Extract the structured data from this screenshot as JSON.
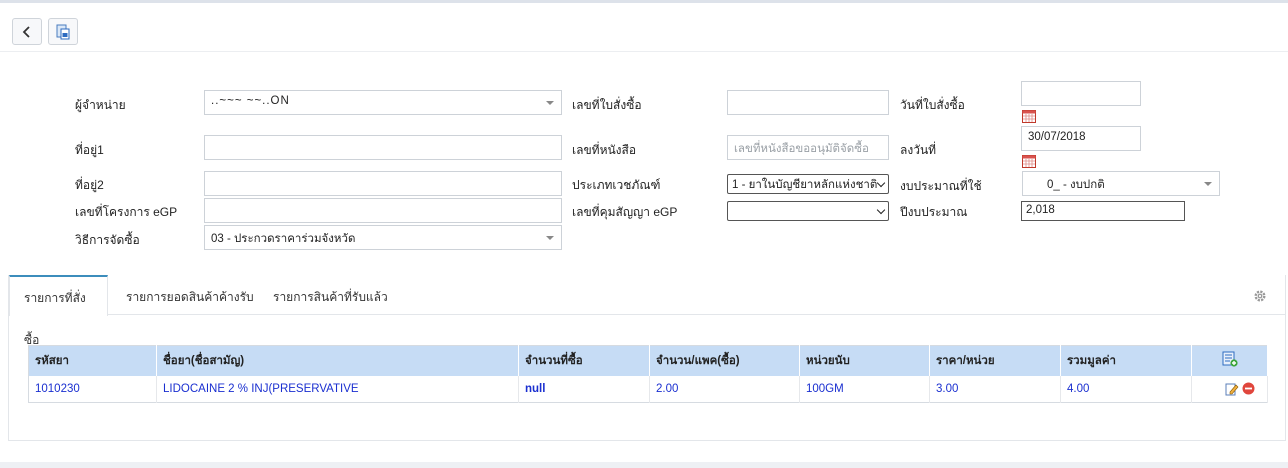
{
  "toolbar": {
    "back_icon": "chevron-left-icon",
    "save_icon": "save-document-icon"
  },
  "form": {
    "vendor_label": "ผู้จำหน่าย",
    "vendor_value": "..~~~  ~~..ON",
    "address1_label": "ที่อยู่1",
    "address1_value": "",
    "address2_label": "ที่อยู่2",
    "address2_value": "",
    "egp_project_label": "เลขที่โครงการ eGP",
    "egp_project_value": "",
    "method_label": "วิธีการจัดซื้อ",
    "method_value": "03 - ประกวดราคาร่วมจังหวัด",
    "po_number_label": "เลขที่ใบสั่งซื้อ",
    "po_number_value": "",
    "letter_no_label": "เลขที่หนังสือ",
    "letter_no_placeholder": "เลขที่หนังสือขออนุมัติจัดซื้อ",
    "drug_type_label": "ประเภทเวชภัณฑ์",
    "drug_type_value": "1 - ยาในบัญชียาหลักแห่งชาติ",
    "contract_egp_label": "เลขที่คุมสัญญา eGP",
    "contract_egp_value": "",
    "po_date_label": "วันที่ใบสั่งซื้อ",
    "po_date_value": "",
    "sign_date_label": "ลงวันที่",
    "sign_date_value": "30/07/2018",
    "budget_label": "งบประมาณที่ใช้",
    "budget_value": "0_ - งบปกติ",
    "fiscal_year_label": "ปีงบประมาณ",
    "fiscal_year_value": "2,018"
  },
  "tabs": [
    "รายการที่สั่งซื้อ",
    "รายการยอดสินค้าค้างรับ",
    "รายการสินค้าที่รับแล้ว"
  ],
  "table": {
    "headers": [
      "รหัสยา",
      "ชื่อยา(ชื่อสามัญ)",
      "จำนวนที่ซื้อ",
      "จำนวน/แพค(ซื้อ)",
      "หน่วยนับ",
      "ราคา/หน่วย",
      "รวมมูลค่า"
    ],
    "rows": [
      [
        "1010230",
        "LIDOCAINE 2 % INJ(PRESERVATIVE",
        "null",
        "2.00",
        "100GM",
        "3.00",
        "4.00"
      ]
    ]
  },
  "colors": {
    "header_bg": "#c6dcf5",
    "link_blue": "#1a2fd0",
    "tab_accent": "#3c8dbc"
  }
}
